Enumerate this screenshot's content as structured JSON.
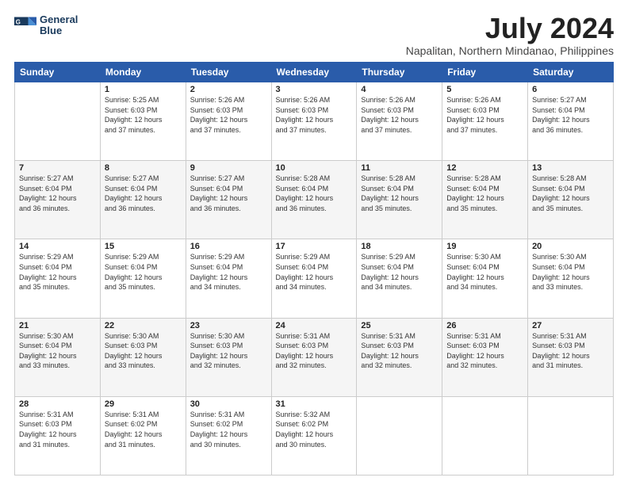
{
  "header": {
    "logo_line1": "General",
    "logo_line2": "Blue",
    "title": "July 2024",
    "subtitle": "Napalitan, Northern Mindanao, Philippines"
  },
  "weekdays": [
    "Sunday",
    "Monday",
    "Tuesday",
    "Wednesday",
    "Thursday",
    "Friday",
    "Saturday"
  ],
  "weeks": [
    [
      {
        "day": "",
        "info": ""
      },
      {
        "day": "1",
        "info": "Sunrise: 5:25 AM\nSunset: 6:03 PM\nDaylight: 12 hours\nand 37 minutes."
      },
      {
        "day": "2",
        "info": "Sunrise: 5:26 AM\nSunset: 6:03 PM\nDaylight: 12 hours\nand 37 minutes."
      },
      {
        "day": "3",
        "info": "Sunrise: 5:26 AM\nSunset: 6:03 PM\nDaylight: 12 hours\nand 37 minutes."
      },
      {
        "day": "4",
        "info": "Sunrise: 5:26 AM\nSunset: 6:03 PM\nDaylight: 12 hours\nand 37 minutes."
      },
      {
        "day": "5",
        "info": "Sunrise: 5:26 AM\nSunset: 6:03 PM\nDaylight: 12 hours\nand 37 minutes."
      },
      {
        "day": "6",
        "info": "Sunrise: 5:27 AM\nSunset: 6:04 PM\nDaylight: 12 hours\nand 36 minutes."
      }
    ],
    [
      {
        "day": "7",
        "info": "Sunrise: 5:27 AM\nSunset: 6:04 PM\nDaylight: 12 hours\nand 36 minutes."
      },
      {
        "day": "8",
        "info": "Sunrise: 5:27 AM\nSunset: 6:04 PM\nDaylight: 12 hours\nand 36 minutes."
      },
      {
        "day": "9",
        "info": "Sunrise: 5:27 AM\nSunset: 6:04 PM\nDaylight: 12 hours\nand 36 minutes."
      },
      {
        "day": "10",
        "info": "Sunrise: 5:28 AM\nSunset: 6:04 PM\nDaylight: 12 hours\nand 36 minutes."
      },
      {
        "day": "11",
        "info": "Sunrise: 5:28 AM\nSunset: 6:04 PM\nDaylight: 12 hours\nand 35 minutes."
      },
      {
        "day": "12",
        "info": "Sunrise: 5:28 AM\nSunset: 6:04 PM\nDaylight: 12 hours\nand 35 minutes."
      },
      {
        "day": "13",
        "info": "Sunrise: 5:28 AM\nSunset: 6:04 PM\nDaylight: 12 hours\nand 35 minutes."
      }
    ],
    [
      {
        "day": "14",
        "info": "Sunrise: 5:29 AM\nSunset: 6:04 PM\nDaylight: 12 hours\nand 35 minutes."
      },
      {
        "day": "15",
        "info": "Sunrise: 5:29 AM\nSunset: 6:04 PM\nDaylight: 12 hours\nand 35 minutes."
      },
      {
        "day": "16",
        "info": "Sunrise: 5:29 AM\nSunset: 6:04 PM\nDaylight: 12 hours\nand 34 minutes."
      },
      {
        "day": "17",
        "info": "Sunrise: 5:29 AM\nSunset: 6:04 PM\nDaylight: 12 hours\nand 34 minutes."
      },
      {
        "day": "18",
        "info": "Sunrise: 5:29 AM\nSunset: 6:04 PM\nDaylight: 12 hours\nand 34 minutes."
      },
      {
        "day": "19",
        "info": "Sunrise: 5:30 AM\nSunset: 6:04 PM\nDaylight: 12 hours\nand 34 minutes."
      },
      {
        "day": "20",
        "info": "Sunrise: 5:30 AM\nSunset: 6:04 PM\nDaylight: 12 hours\nand 33 minutes."
      }
    ],
    [
      {
        "day": "21",
        "info": "Sunrise: 5:30 AM\nSunset: 6:04 PM\nDaylight: 12 hours\nand 33 minutes."
      },
      {
        "day": "22",
        "info": "Sunrise: 5:30 AM\nSunset: 6:03 PM\nDaylight: 12 hours\nand 33 minutes."
      },
      {
        "day": "23",
        "info": "Sunrise: 5:30 AM\nSunset: 6:03 PM\nDaylight: 12 hours\nand 32 minutes."
      },
      {
        "day": "24",
        "info": "Sunrise: 5:31 AM\nSunset: 6:03 PM\nDaylight: 12 hours\nand 32 minutes."
      },
      {
        "day": "25",
        "info": "Sunrise: 5:31 AM\nSunset: 6:03 PM\nDaylight: 12 hours\nand 32 minutes."
      },
      {
        "day": "26",
        "info": "Sunrise: 5:31 AM\nSunset: 6:03 PM\nDaylight: 12 hours\nand 32 minutes."
      },
      {
        "day": "27",
        "info": "Sunrise: 5:31 AM\nSunset: 6:03 PM\nDaylight: 12 hours\nand 31 minutes."
      }
    ],
    [
      {
        "day": "28",
        "info": "Sunrise: 5:31 AM\nSunset: 6:03 PM\nDaylight: 12 hours\nand 31 minutes."
      },
      {
        "day": "29",
        "info": "Sunrise: 5:31 AM\nSunset: 6:02 PM\nDaylight: 12 hours\nand 31 minutes."
      },
      {
        "day": "30",
        "info": "Sunrise: 5:31 AM\nSunset: 6:02 PM\nDaylight: 12 hours\nand 30 minutes."
      },
      {
        "day": "31",
        "info": "Sunrise: 5:32 AM\nSunset: 6:02 PM\nDaylight: 12 hours\nand 30 minutes."
      },
      {
        "day": "",
        "info": ""
      },
      {
        "day": "",
        "info": ""
      },
      {
        "day": "",
        "info": ""
      }
    ]
  ]
}
